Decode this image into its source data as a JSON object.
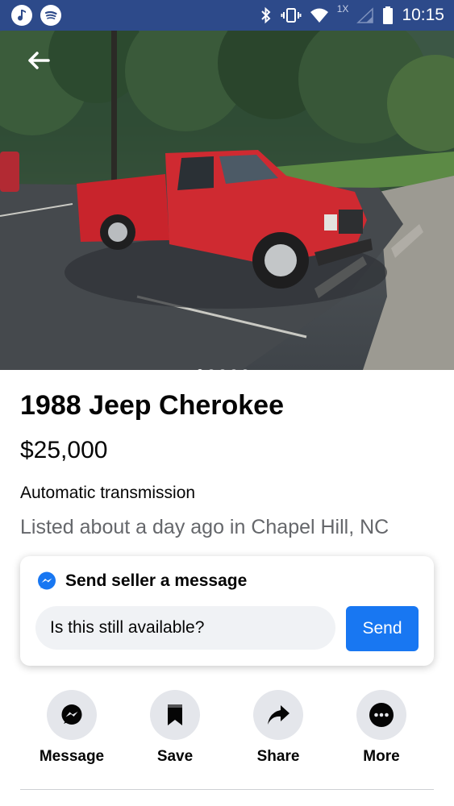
{
  "status_bar": {
    "time": "10:15",
    "network_badge": "1X",
    "icons": [
      "music-app-icon",
      "spotify-icon",
      "bluetooth-icon",
      "vibrate-icon",
      "wifi-icon",
      "signal-icon",
      "battery-icon"
    ]
  },
  "photo": {
    "image_count": 5,
    "active_index": 0
  },
  "listing": {
    "title": "1988 Jeep Cherokee",
    "price": "$25,000",
    "transmission": "Automatic transmission",
    "listed": "Listed about a day ago in Chapel Hill, NC"
  },
  "message_card": {
    "heading": "Send seller a message",
    "input_value": "Is this still available?",
    "send_label": "Send"
  },
  "actions": [
    {
      "label": "Message",
      "icon": "messenger-icon"
    },
    {
      "label": "Save",
      "icon": "bookmark-icon"
    },
    {
      "label": "Share",
      "icon": "share-arrow-icon"
    },
    {
      "label": "More",
      "icon": "more-dots-icon"
    }
  ],
  "colors": {
    "status_bar": "#2d4a8a",
    "accent": "#1877f2",
    "action_circle": "#e4e6eb",
    "secondary_text": "#65676b",
    "truck_red": "#c8242c"
  }
}
